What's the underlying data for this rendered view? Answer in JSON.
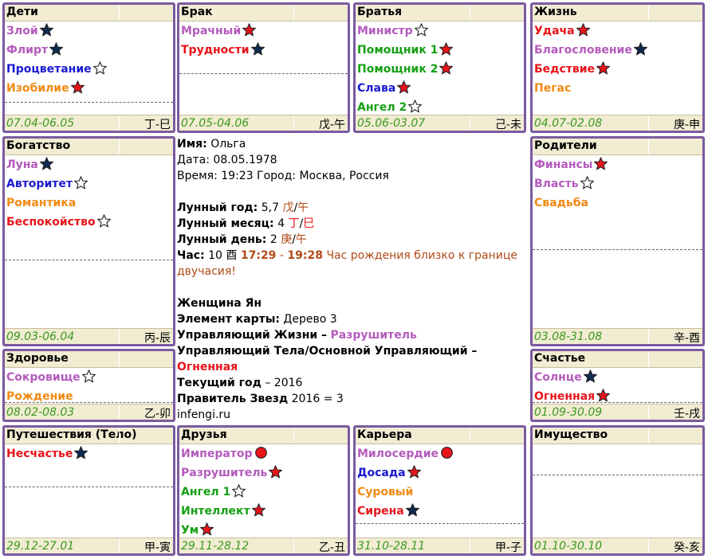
{
  "palaces": [
    {
      "id": "children",
      "name": "Дети",
      "range": "07.04-06.05",
      "branch": "丁-巳",
      "dash": [
        122
      ],
      "stars": [
        {
          "label": "Злой",
          "color": "purple",
          "icon": "star-navy"
        },
        {
          "label": "Флирт",
          "color": "purple",
          "icon": "star-navy"
        },
        {
          "label": "Процветание",
          "color": "blue",
          "icon": "star-outline"
        },
        {
          "label": "Изобилие",
          "color": "orange",
          "icon": "star-red"
        }
      ]
    },
    {
      "id": "marriage",
      "name": "Брак",
      "range": "07.05-04.06",
      "branch": "戊-午",
      "dash": [
        86
      ],
      "stars": [
        {
          "label": "Мрачный",
          "color": "purple",
          "icon": "star-red"
        },
        {
          "label": "Трудности",
          "color": "red",
          "icon": "star-navy"
        }
      ]
    },
    {
      "id": "brothers",
      "name": "Братья",
      "range": "05.06-03.07",
      "branch": "己-未",
      "dash": [
        140
      ],
      "stars": [
        {
          "label": "Министр",
          "color": "purple",
          "icon": "star-outline"
        },
        {
          "label": "Помощник 1",
          "color": "green",
          "icon": "star-red"
        },
        {
          "label": "Помощник 2",
          "color": "green",
          "icon": "star-red"
        },
        {
          "label": "Слава",
          "color": "blue",
          "icon": "star-red"
        },
        {
          "label": "Ангел 2",
          "color": "green",
          "icon": "star-outline"
        }
      ]
    },
    {
      "id": "life",
      "name": "Жизнь",
      "range": "04.07-02.08",
      "branch": "庚-申",
      "dash": [],
      "stars": [
        {
          "label": "Удача",
          "color": "red",
          "icon": "star-red"
        },
        {
          "label": "Благословение",
          "color": "purple",
          "icon": "star-navy"
        },
        {
          "label": "Бедствие",
          "color": "red",
          "icon": "star-red"
        },
        {
          "label": "Пегас",
          "color": "orange",
          "icon": ""
        }
      ]
    },
    {
      "id": "wealth",
      "name": "Богатство",
      "range": "09.03-06.04",
      "branch": "丙-辰",
      "dash": [
        152
      ],
      "stars": [
        {
          "label": "Луна",
          "color": "purple",
          "icon": "star-navy"
        },
        {
          "label": "Авторитет",
          "color": "blue",
          "icon": "star-outline"
        },
        {
          "label": "Романтика",
          "color": "orange",
          "icon": ""
        },
        {
          "label": "Беспокойство",
          "color": "red",
          "icon": "star-outline"
        }
      ]
    },
    {
      "id": "parents",
      "name": "Родители",
      "range": "03.08-31.08",
      "branch": "辛-酉",
      "dash": [
        139
      ],
      "stars": [
        {
          "label": "Финансы",
          "color": "purple",
          "icon": "star-red"
        },
        {
          "label": "Власть",
          "color": "purple",
          "icon": "star-outline"
        },
        {
          "label": "Свадьба",
          "color": "orange",
          "icon": ""
        }
      ]
    },
    {
      "id": "health",
      "name": "Здоровье",
      "range": "08.02-08.03",
      "branch": "乙-卯",
      "dash": [
        64
      ],
      "stars": [
        {
          "label": "Сокровище",
          "color": "purple",
          "icon": "star-outline"
        },
        {
          "label": "Рождение",
          "color": "orange",
          "icon": ""
        }
      ]
    },
    {
      "id": "happiness",
      "name": "Счастье",
      "range": "01.09-30.09",
      "branch": "壬-戌",
      "dash": [
        64
      ],
      "stars": [
        {
          "label": "Солнце",
          "color": "purple",
          "icon": "star-navy"
        },
        {
          "label": "Огненная",
          "color": "red",
          "icon": "star-red"
        }
      ]
    },
    {
      "id": "travel",
      "name": "Путешествия (Тело)",
      "range": "29.12-27.01",
      "branch": "甲-寅",
      "dash": [
        74
      ],
      "stars": [
        {
          "label": "Несчастье",
          "color": "red",
          "icon": "star-navy"
        }
      ]
    },
    {
      "id": "friends",
      "name": "Друзья",
      "range": "29.11-28.12",
      "branch": "乙-丑",
      "dash": [
        139
      ],
      "stars": [
        {
          "label": "Император",
          "color": "purple",
          "icon": "dot-red"
        },
        {
          "label": "Разрушитель",
          "color": "purple",
          "icon": "star-red"
        },
        {
          "label": "Ангел 1",
          "color": "green",
          "icon": "star-outline"
        },
        {
          "label": "Интеллект",
          "color": "green",
          "icon": "star-red"
        },
        {
          "label": "Ум",
          "color": "green",
          "icon": "star-red"
        }
      ]
    },
    {
      "id": "career",
      "name": "Карьера",
      "range": "31.10-28.11",
      "branch": "甲-子",
      "dash": [
        120
      ],
      "stars": [
        {
          "label": "Милосердие",
          "color": "purple",
          "icon": "dot-red"
        },
        {
          "label": "Досада",
          "color": "blue",
          "icon": "star-red"
        },
        {
          "label": "Суровый",
          "color": "orange",
          "icon": ""
        },
        {
          "label": "Сирена",
          "color": "red",
          "icon": "star-navy"
        }
      ]
    },
    {
      "id": "property",
      "name": "Имущество",
      "range": "01.10-30.10",
      "branch": "癸-亥",
      "dash": [
        59
      ],
      "stars": []
    }
  ],
  "center": {
    "name_label": "Имя:",
    "name_value": "Ольга",
    "date_text": "Дата: 08.05.1978",
    "time_text": "Время: 19:23 Город: Москва, Россия",
    "lunar_year_label": "Лунный год:",
    "lunar_year_value": "5,7",
    "lunar_year_stem": "戊",
    "lunar_year_branch": "午",
    "lunar_month_label": "Лунный месяц:",
    "lunar_month_value": "4",
    "lunar_month_stem": "丁",
    "lunar_month_branch": "巳",
    "lunar_day_label": "Лунный день:",
    "lunar_day_value": "2",
    "lunar_day_stem": "庚",
    "lunar_day_branch": "午",
    "hour_label": "Час:",
    "hour_value": "10",
    "hour_branch": "酉",
    "hour_start": "17:29",
    "hour_dash": "-",
    "hour_end": "19:28",
    "hour_note": "Час рождения близко к границе двучасия!",
    "gender": "Женщина Ян",
    "element_label": "Элемент карты:",
    "element_value": "Дерево 3",
    "life_ruler_label": "Управляющий Жизни –",
    "life_ruler_value": "Разрушитель",
    "body_ruler_label": "Управляющий Тела/Основной Управляющий –",
    "body_ruler_value": "Огненная",
    "current_year_label": "Текущий год",
    "current_year_value": "– 2016",
    "star_ruler_label": "Правитель Звезд",
    "star_ruler_value": "2016 = 3",
    "site": "infengi.ru"
  },
  "colors": {
    "purple": "#b45bbd",
    "red": "#e8141a",
    "blue": "#1a1ad0",
    "green": "#14a014",
    "orange": "#f08a14",
    "brown": "#b04a18",
    "navy": "#0d2a50",
    "border": "#7a5aa0",
    "header_bg": "#f1ecd2",
    "range_green": "#3a9a20"
  }
}
